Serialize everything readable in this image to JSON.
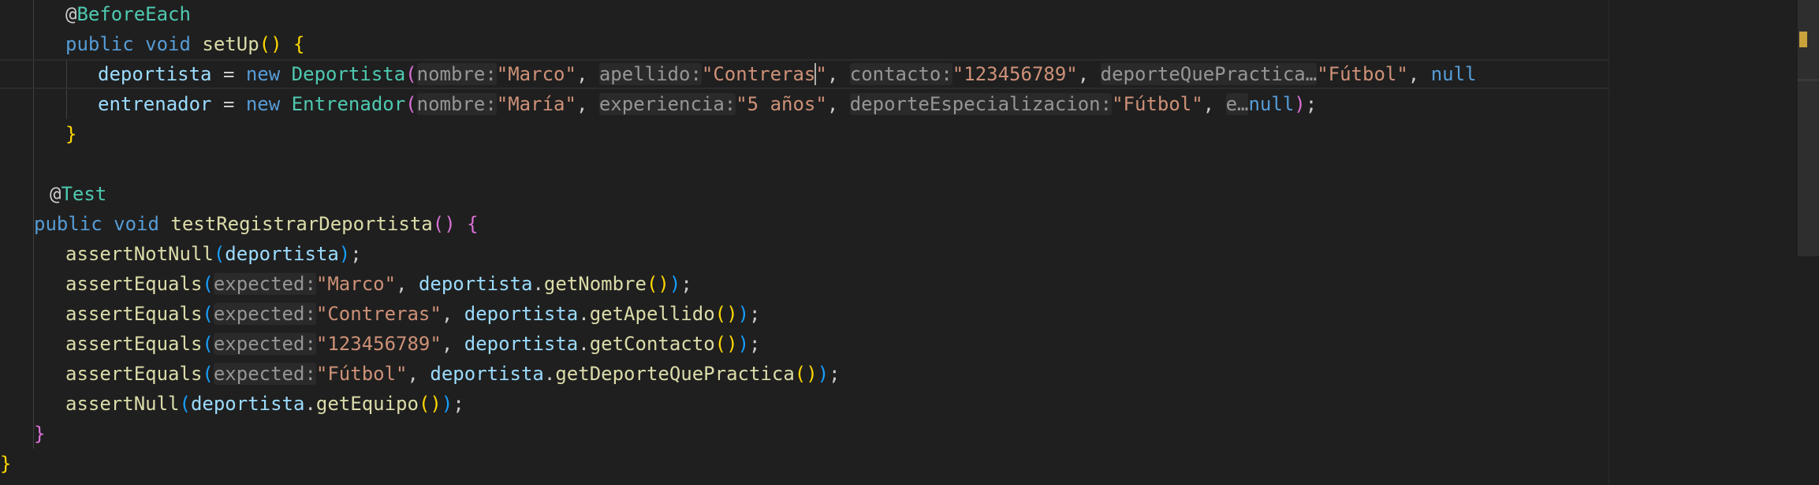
{
  "editor": {
    "lines": [
      {
        "indent": 2,
        "tokens": [
          {
            "t": "@",
            "c": "plain"
          },
          {
            "t": "BeforeEach",
            "c": "ann"
          }
        ]
      },
      {
        "indent": 2,
        "tokens": [
          {
            "t": "public",
            "c": "kw"
          },
          {
            "t": " ",
            "c": "plain"
          },
          {
            "t": "void",
            "c": "kw"
          },
          {
            "t": " ",
            "c": "plain"
          },
          {
            "t": "setUp",
            "c": "fn"
          },
          {
            "t": "()",
            "c": "p1"
          },
          {
            "t": " ",
            "c": "plain"
          },
          {
            "t": "{",
            "c": "p1"
          }
        ]
      },
      {
        "indent": 3,
        "current": true,
        "tokens": [
          {
            "t": "deportista",
            "c": "var"
          },
          {
            "t": " = ",
            "c": "plain"
          },
          {
            "t": "new",
            "c": "kw"
          },
          {
            "t": " ",
            "c": "plain"
          },
          {
            "t": "Deportista",
            "c": "cls"
          },
          {
            "t": "(",
            "c": "p2"
          },
          {
            "t": "nombre:",
            "c": "hint"
          },
          {
            "t": "\"Marco\"",
            "c": "str"
          },
          {
            "t": ", ",
            "c": "plain"
          },
          {
            "t": "apellido:",
            "c": "hint"
          },
          {
            "t": "\"Contreras",
            "c": "str"
          },
          {
            "t": "|",
            "c": "cursor"
          },
          {
            "t": "\"",
            "c": "str"
          },
          {
            "t": ", ",
            "c": "plain"
          },
          {
            "t": "contacto:",
            "c": "hint"
          },
          {
            "t": "\"123456789\"",
            "c": "str"
          },
          {
            "t": ", ",
            "c": "plain"
          },
          {
            "t": "deporteQuePractica…",
            "c": "hint"
          },
          {
            "t": "\"Fútbol\"",
            "c": "str"
          },
          {
            "t": ", ",
            "c": "plain"
          },
          {
            "t": "null",
            "c": "kw"
          }
        ]
      },
      {
        "indent": 3,
        "tokens": [
          {
            "t": "entrenador",
            "c": "var"
          },
          {
            "t": " = ",
            "c": "plain"
          },
          {
            "t": "new",
            "c": "kw"
          },
          {
            "t": " ",
            "c": "plain"
          },
          {
            "t": "Entrenador",
            "c": "cls"
          },
          {
            "t": "(",
            "c": "p2"
          },
          {
            "t": "nombre:",
            "c": "hint"
          },
          {
            "t": "\"María\"",
            "c": "str"
          },
          {
            "t": ", ",
            "c": "plain"
          },
          {
            "t": "experiencia:",
            "c": "hint"
          },
          {
            "t": "\"5 años\"",
            "c": "str"
          },
          {
            "t": ", ",
            "c": "plain"
          },
          {
            "t": "deporteEspecializacion:",
            "c": "hint"
          },
          {
            "t": "\"Fútbol\"",
            "c": "str"
          },
          {
            "t": ", ",
            "c": "plain"
          },
          {
            "t": "e…",
            "c": "hint"
          },
          {
            "t": "null",
            "c": "kw"
          },
          {
            "t": ")",
            "c": "p2"
          },
          {
            "t": ";",
            "c": "plain"
          }
        ]
      },
      {
        "indent": 2,
        "tokens": [
          {
            "t": "}",
            "c": "p1"
          }
        ]
      },
      {
        "indent": 0,
        "tokens": []
      },
      {
        "indent": 1.5,
        "tokens": [
          {
            "t": "@",
            "c": "plain"
          },
          {
            "t": "Test",
            "c": "ann"
          }
        ]
      },
      {
        "indent": 1,
        "tokens": [
          {
            "t": "public",
            "c": "kw"
          },
          {
            "t": " ",
            "c": "plain"
          },
          {
            "t": "void",
            "c": "kw"
          },
          {
            "t": " ",
            "c": "plain"
          },
          {
            "t": "testRegistrarDeportista",
            "c": "fn"
          },
          {
            "t": "()",
            "c": "p2"
          },
          {
            "t": " ",
            "c": "plain"
          },
          {
            "t": "{",
            "c": "p2"
          }
        ]
      },
      {
        "indent": 2,
        "tokens": [
          {
            "t": "assertNotNull",
            "c": "fn"
          },
          {
            "t": "(",
            "c": "p3"
          },
          {
            "t": "deportista",
            "c": "var"
          },
          {
            "t": ")",
            "c": "p3"
          },
          {
            "t": ";",
            "c": "plain"
          }
        ]
      },
      {
        "indent": 2,
        "tokens": [
          {
            "t": "assertEquals",
            "c": "fn"
          },
          {
            "t": "(",
            "c": "p3"
          },
          {
            "t": "expected:",
            "c": "hint"
          },
          {
            "t": "\"Marco\"",
            "c": "str"
          },
          {
            "t": ", ",
            "c": "plain"
          },
          {
            "t": "deportista",
            "c": "var"
          },
          {
            "t": ".",
            "c": "plain"
          },
          {
            "t": "getNombre",
            "c": "fn"
          },
          {
            "t": "()",
            "c": "p1"
          },
          {
            "t": ")",
            "c": "p3"
          },
          {
            "t": ";",
            "c": "plain"
          }
        ]
      },
      {
        "indent": 2,
        "tokens": [
          {
            "t": "assertEquals",
            "c": "fn"
          },
          {
            "t": "(",
            "c": "p3"
          },
          {
            "t": "expected:",
            "c": "hint"
          },
          {
            "t": "\"Contreras\"",
            "c": "str"
          },
          {
            "t": ", ",
            "c": "plain"
          },
          {
            "t": "deportista",
            "c": "var"
          },
          {
            "t": ".",
            "c": "plain"
          },
          {
            "t": "getApellido",
            "c": "fn"
          },
          {
            "t": "()",
            "c": "p1"
          },
          {
            "t": ")",
            "c": "p3"
          },
          {
            "t": ";",
            "c": "plain"
          }
        ]
      },
      {
        "indent": 2,
        "tokens": [
          {
            "t": "assertEquals",
            "c": "fn"
          },
          {
            "t": "(",
            "c": "p3"
          },
          {
            "t": "expected:",
            "c": "hint"
          },
          {
            "t": "\"123456789\"",
            "c": "str"
          },
          {
            "t": ", ",
            "c": "plain"
          },
          {
            "t": "deportista",
            "c": "var"
          },
          {
            "t": ".",
            "c": "plain"
          },
          {
            "t": "getContacto",
            "c": "fn"
          },
          {
            "t": "()",
            "c": "p1"
          },
          {
            "t": ")",
            "c": "p3"
          },
          {
            "t": ";",
            "c": "plain"
          }
        ]
      },
      {
        "indent": 2,
        "tokens": [
          {
            "t": "assertEquals",
            "c": "fn"
          },
          {
            "t": "(",
            "c": "p3"
          },
          {
            "t": "expected:",
            "c": "hint"
          },
          {
            "t": "\"Fútbol\"",
            "c": "str"
          },
          {
            "t": ", ",
            "c": "plain"
          },
          {
            "t": "deportista",
            "c": "var"
          },
          {
            "t": ".",
            "c": "plain"
          },
          {
            "t": "getDeporteQuePractica",
            "c": "fn"
          },
          {
            "t": "()",
            "c": "p1"
          },
          {
            "t": ")",
            "c": "p3"
          },
          {
            "t": ";",
            "c": "plain"
          }
        ]
      },
      {
        "indent": 2,
        "tokens": [
          {
            "t": "assertNull",
            "c": "fn"
          },
          {
            "t": "(",
            "c": "p3"
          },
          {
            "t": "deportista",
            "c": "var"
          },
          {
            "t": ".",
            "c": "plain"
          },
          {
            "t": "getEquipo",
            "c": "fn"
          },
          {
            "t": "()",
            "c": "p1"
          },
          {
            "t": ")",
            "c": "p3"
          },
          {
            "t": ";",
            "c": "plain"
          }
        ]
      },
      {
        "indent": 1,
        "tokens": [
          {
            "t": "}",
            "c": "p2"
          }
        ]
      },
      {
        "indent": 0,
        "tokens": [
          {
            "t": "}",
            "c": "p1"
          }
        ]
      }
    ]
  },
  "theme": {
    "background": "#1f1f1f",
    "keyword": "#569cd6",
    "annotation": "#4ec9b0",
    "function": "#dcdcaa",
    "variable": "#9cdcfe",
    "string": "#ce9178",
    "hint_text": "#969696",
    "bracket_gold": "#ffd700",
    "bracket_orchid": "#da70d6",
    "bracket_blue": "#179fff",
    "scroll_marker": "#c9a23c"
  }
}
